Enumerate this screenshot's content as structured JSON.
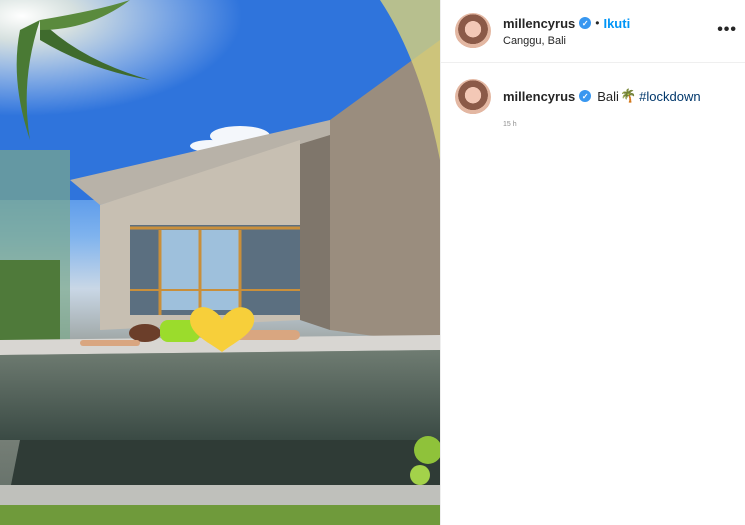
{
  "post": {
    "username": "millencyrus",
    "location": "Canggu, Bali",
    "follow_label": "Ikuti",
    "separator": "•",
    "more_label": "•••",
    "verified_glyph": "✓"
  },
  "comment": {
    "username": "millencyrus",
    "caption_text": "Bali",
    "palm_emoji": "🌴",
    "hashtag": "#lockdown",
    "timestamp": "15 h"
  },
  "colors": {
    "link_blue": "#0095f6",
    "hashtag_blue": "#00376b",
    "verified_blue": "#3897f0",
    "border": "#efefef"
  },
  "icons": [
    "verified-badge-icon",
    "more-options-icon",
    "palm-tree-emoji"
  ]
}
